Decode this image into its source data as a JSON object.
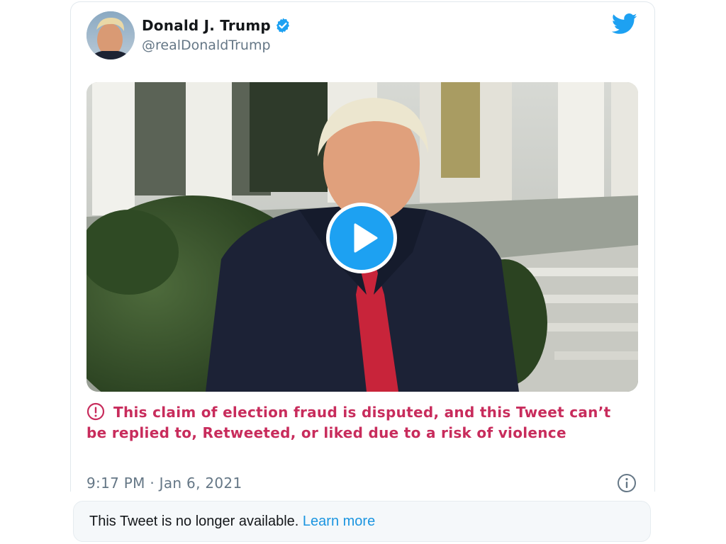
{
  "tweet": {
    "author_name": "Donald J. Trump",
    "handle": "@realDonaldTrump",
    "verified": true,
    "warning_text": "This claim of election fraud is disputed, and this Tweet can’t be replied to, Retweeted, or liked due to a risk of violence",
    "timestamp": "9:17 PM · Jan 6, 2021"
  },
  "notice": {
    "text": "This Tweet is no longer available.",
    "link": "Learn more"
  },
  "icons": {
    "bird": "twitter-bird-icon",
    "verified": "verified-badge-icon",
    "warning": "exclamation-circle-icon",
    "info": "info-icon",
    "play": "play-icon"
  },
  "colors": {
    "brand": "#1da1f2",
    "warning": "#c82c5c",
    "link": "#1b95e0",
    "muted": "#657786"
  }
}
